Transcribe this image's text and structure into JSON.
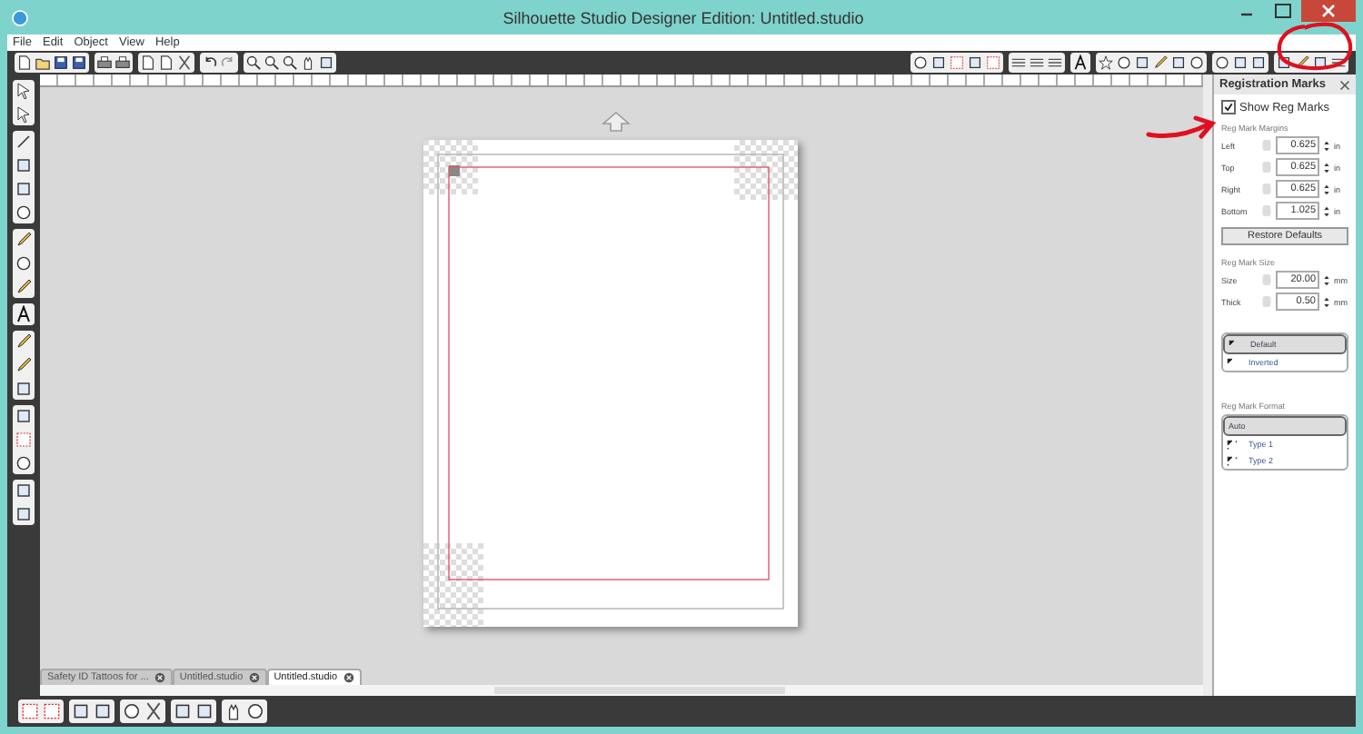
{
  "window": {
    "title": "Silhouette Studio Designer Edition: Untitled.studio"
  },
  "menu": [
    "File",
    "Edit",
    "Object",
    "View",
    "Help"
  ],
  "document_tabs": [
    {
      "label": "Safety ID Tattoos for ...",
      "selected": false
    },
    {
      "label": "Untitled.studio",
      "selected": false
    },
    {
      "label": "Untitled.studio",
      "selected": true
    }
  ],
  "panel": {
    "title": "Registration Marks",
    "show_reg_marks": {
      "label": "Show Reg Marks",
      "checked": true
    },
    "margins_label": "Reg Mark Margins",
    "margins": [
      {
        "label": "Left",
        "value": "0.625",
        "unit": "in"
      },
      {
        "label": "Top",
        "value": "0.625",
        "unit": "in"
      },
      {
        "label": "Right",
        "value": "0.625",
        "unit": "in"
      },
      {
        "label": "Bottom",
        "value": "1.025",
        "unit": "in"
      }
    ],
    "restore_button": "Restore Defaults",
    "size_label": "Reg Mark Size",
    "size": [
      {
        "label": "Size",
        "value": "20.00",
        "unit": "mm"
      },
      {
        "label": "Thick",
        "value": "0.50",
        "unit": "mm"
      }
    ],
    "styles": [
      {
        "label": "Default",
        "selected": true
      },
      {
        "label": "Inverted",
        "selected": false
      }
    ],
    "format_label": "Reg Mark Format",
    "formats": [
      {
        "label": "Auto",
        "selected": true
      },
      {
        "label": "Type 1",
        "selected": false
      },
      {
        "label": "Type 2",
        "selected": false
      }
    ]
  }
}
